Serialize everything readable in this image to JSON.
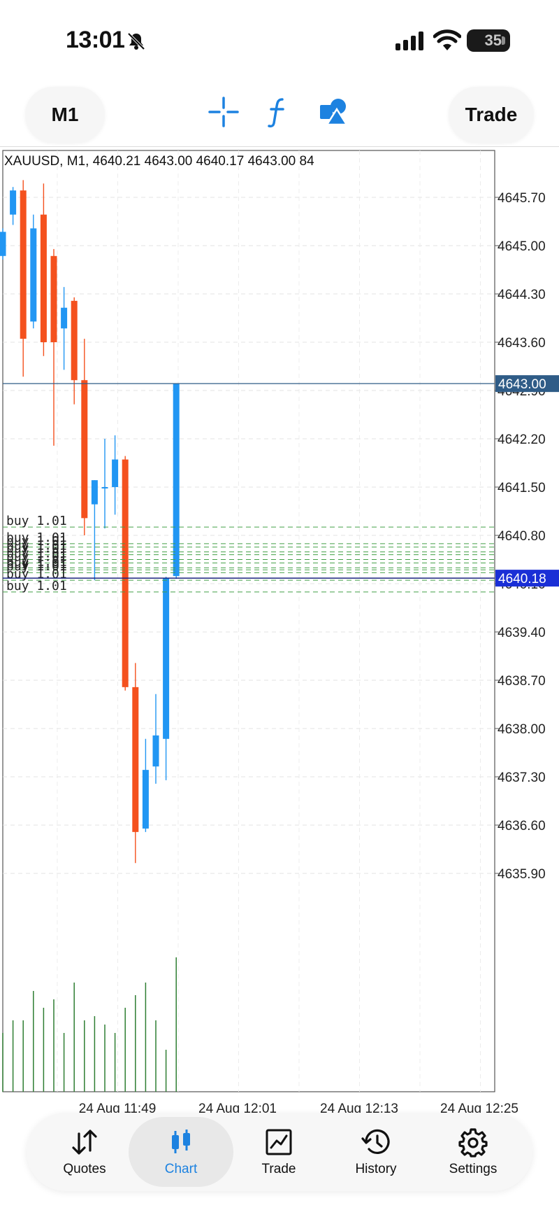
{
  "status_bar": {
    "time": "13:01",
    "battery": "35"
  },
  "toolbar": {
    "timeframe": "M1",
    "trade_label": "Trade",
    "icons": [
      "crosshair-icon",
      "indicators-icon",
      "objects-icon"
    ]
  },
  "chart": {
    "ohlc_header": "XAUUSD, M1, 4640.21 4643.00 4640.17 4643.00 84",
    "colors": {
      "bull": "#2196f3",
      "bear": "#f4511e",
      "volume": "#2e7d32",
      "order_line": "#43a047",
      "last_price": "#1a237e",
      "bid_tag": "#2f5c87"
    }
  },
  "chart_data": {
    "type": "candlestick",
    "symbol": "XAUUSD",
    "timeframe": "M1",
    "header": {
      "open": 4640.21,
      "high": 4643.0,
      "low": 4640.17,
      "close": 4643.0,
      "volume": 84
    },
    "y_ticks": [
      "4645.70",
      "4645.00",
      "4644.30",
      "4643.60",
      "4642.90",
      "4642.20",
      "4641.50",
      "4640.80",
      "4640.10",
      "4639.40",
      "4638.70",
      "4638.00",
      "4637.30",
      "4636.60",
      "4635.90"
    ],
    "x_ticks": [
      "24 Aug 11:49",
      "24 Aug 12:01",
      "24 Aug 12:13",
      "24 Aug 12:25"
    ],
    "ylim": [
      4635.6,
      4646.2
    ],
    "price_tags": [
      {
        "value": 4643.0,
        "label": "4643.00",
        "kind": "bid"
      },
      {
        "value": 4640.18,
        "label": "4640.18",
        "kind": "last"
      }
    ],
    "candles": [
      {
        "o": 4644.85,
        "h": 4645.25,
        "l": 4644.8,
        "c": 4645.2
      },
      {
        "o": 4645.45,
        "h": 4645.85,
        "l": 4645.3,
        "c": 4645.8
      },
      {
        "o": 4645.8,
        "h": 4645.95,
        "l": 4643.1,
        "c": 4643.65
      },
      {
        "o": 4643.9,
        "h": 4645.45,
        "l": 4643.8,
        "c": 4645.25
      },
      {
        "o": 4645.45,
        "h": 4645.9,
        "l": 4643.4,
        "c": 4643.6
      },
      {
        "o": 4644.85,
        "h": 4644.95,
        "l": 4642.1,
        "c": 4643.6
      },
      {
        "o": 4643.8,
        "h": 4644.4,
        "l": 4643.2,
        "c": 4644.1
      },
      {
        "o": 4644.2,
        "h": 4644.25,
        "l": 4642.7,
        "c": 4643.05
      },
      {
        "o": 4643.05,
        "h": 4643.65,
        "l": 4640.8,
        "c": 4641.05
      },
      {
        "o": 4641.25,
        "h": 4641.6,
        "l": 4640.15,
        "c": 4641.6
      },
      {
        "o": 4641.5,
        "h": 4642.2,
        "l": 4640.9,
        "c": 4641.5
      },
      {
        "o": 4641.5,
        "h": 4642.25,
        "l": 4641.1,
        "c": 4641.9
      },
      {
        "o": 4641.9,
        "h": 4641.95,
        "l": 4638.55,
        "c": 4638.6
      },
      {
        "o": 4638.6,
        "h": 4638.95,
        "l": 4636.05,
        "c": 4636.5
      },
      {
        "o": 4636.55,
        "h": 4637.85,
        "l": 4636.5,
        "c": 4637.4
      },
      {
        "o": 4637.45,
        "h": 4638.5,
        "l": 4637.2,
        "c": 4637.9
      },
      {
        "o": 4637.85,
        "h": 4640.2,
        "l": 4637.25,
        "c": 4640.18
      },
      {
        "o": 4640.21,
        "h": 4643.0,
        "l": 4640.17,
        "c": 4643.0
      }
    ],
    "volumes": [
      66,
      69,
      69,
      76,
      72,
      74,
      66,
      78,
      69,
      70,
      68,
      66,
      72,
      75,
      78,
      69,
      62,
      84
    ],
    "buy_orders": [
      {
        "price": 4640.92,
        "label": "buy 1.01"
      },
      {
        "price": 4640.68,
        "label": "buy 1.01"
      },
      {
        "price": 4640.63,
        "label": "buy 1.01"
      },
      {
        "price": 4640.56,
        "label": "buy 1.01"
      },
      {
        "price": 4640.52,
        "label": "buy 1.01"
      },
      {
        "price": 4640.45,
        "label": "buy 1.01"
      },
      {
        "price": 4640.4,
        "label": "buy 1.01"
      },
      {
        "price": 4640.33,
        "label": "buy 1.01"
      },
      {
        "price": 4640.3,
        "label": "buy 1.01"
      },
      {
        "price": 4640.26,
        "label": "buy 1.01"
      },
      {
        "price": 4640.15,
        "label": "buy 1.01"
      },
      {
        "price": 4639.98,
        "label": "buy 1.01"
      }
    ]
  },
  "bottom_nav": {
    "items": [
      {
        "label": "Quotes",
        "icon": "quotes-arrows-icon"
      },
      {
        "label": "Chart",
        "icon": "candlestick-icon",
        "active": true
      },
      {
        "label": "Trade",
        "icon": "trade-chart-icon"
      },
      {
        "label": "History",
        "icon": "history-clock-icon"
      },
      {
        "label": "Settings",
        "icon": "settings-gear-icon"
      }
    ]
  }
}
